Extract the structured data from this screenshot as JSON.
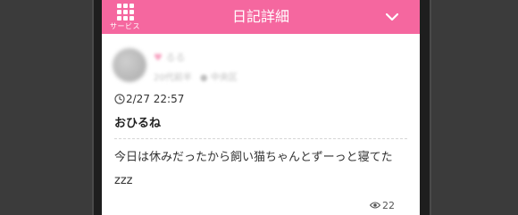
{
  "header": {
    "menu_label": "サービス",
    "title": "日記詳細"
  },
  "profile": {
    "name": "るる",
    "meta_left": "20代前半",
    "meta_right": "中央区"
  },
  "diary": {
    "date": "2/27 22:57",
    "title": "おひるね",
    "body": "今日は休みだったから飼い猫ちゃんとずーっと寝てたzzz",
    "views": "22"
  },
  "colors": {
    "header_bg": "#f5679f",
    "background": "#3b3b3b"
  },
  "icons": [
    "grid-menu-icon",
    "chevron-down-icon",
    "clock-icon",
    "eye-icon",
    "heart-icon"
  ]
}
